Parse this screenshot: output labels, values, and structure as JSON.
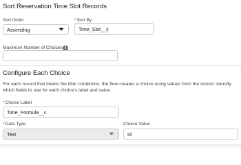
{
  "sort_section": {
    "title": "Sort Reservation Time Slot Records",
    "sort_order": {
      "label": "Sort Order",
      "value": "Ascending"
    },
    "sort_by": {
      "required_mark": "*",
      "label": "Sort By",
      "value": "Time_Slot__c"
    },
    "max_choices": {
      "label": "Maximum Number of Choices",
      "value": "",
      "icon": "info-icon"
    }
  },
  "configure_section": {
    "title": "Configure Each Choice",
    "description": "For each record that meets the filter conditions, the flow creates a choice using values from the record. Identify which fields to use for each choice's label and value.",
    "choice_label": {
      "required_mark": "*",
      "label": "Choice Label",
      "value": "Time_Formula__c"
    },
    "data_type": {
      "required_mark": "*",
      "label": "Data Type",
      "value": "Text"
    },
    "choice_value": {
      "label": "Choice Value",
      "value": "Id"
    }
  },
  "colors": {
    "required": "#c23934",
    "border": "#c9c9c9",
    "disabled_bg": "#ecebea"
  }
}
